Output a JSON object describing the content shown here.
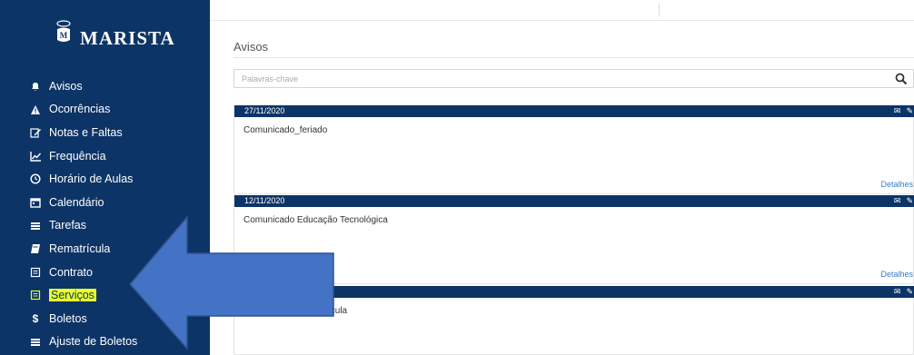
{
  "sidebar": {
    "logo_text": "MARISTA",
    "items": [
      {
        "label": "Avisos",
        "icon": "bell-icon"
      },
      {
        "label": "Ocorrências",
        "icon": "warning-icon"
      },
      {
        "label": "Notas e Faltas",
        "icon": "edit-icon"
      },
      {
        "label": "Frequência",
        "icon": "chart-line-icon"
      },
      {
        "label": "Horário de Aulas",
        "icon": "clock-icon"
      },
      {
        "label": "Calendário",
        "icon": "calendar-icon"
      },
      {
        "label": "Tarefas",
        "icon": "list-icon"
      },
      {
        "label": "Rematrícula",
        "icon": "book-icon"
      },
      {
        "label": "Contrato",
        "icon": "document-icon"
      },
      {
        "label": "Serviços",
        "icon": "document-icon",
        "active": true
      },
      {
        "label": "Boletos",
        "icon": "dollar-icon"
      },
      {
        "label": "Ajuste de Boletos",
        "icon": "list-icon"
      }
    ],
    "highlight_color": "#e8ff2a"
  },
  "main": {
    "title": "Avisos",
    "search": {
      "placeholder": "Palavras-chave"
    },
    "notices": [
      {
        "date": "27/11/2020",
        "title": "Comunicado_feriado",
        "details": "Detalhes"
      },
      {
        "date": "12/11/2020",
        "title": "Comunicado Educação Tecnológica",
        "details": "Detalhes"
      },
      {
        "date": "",
        "title": "ícula",
        "details": ""
      }
    ]
  },
  "colors": {
    "brand": "#0d3466",
    "link": "#3a7bc8",
    "arrow": "#4472c4"
  }
}
